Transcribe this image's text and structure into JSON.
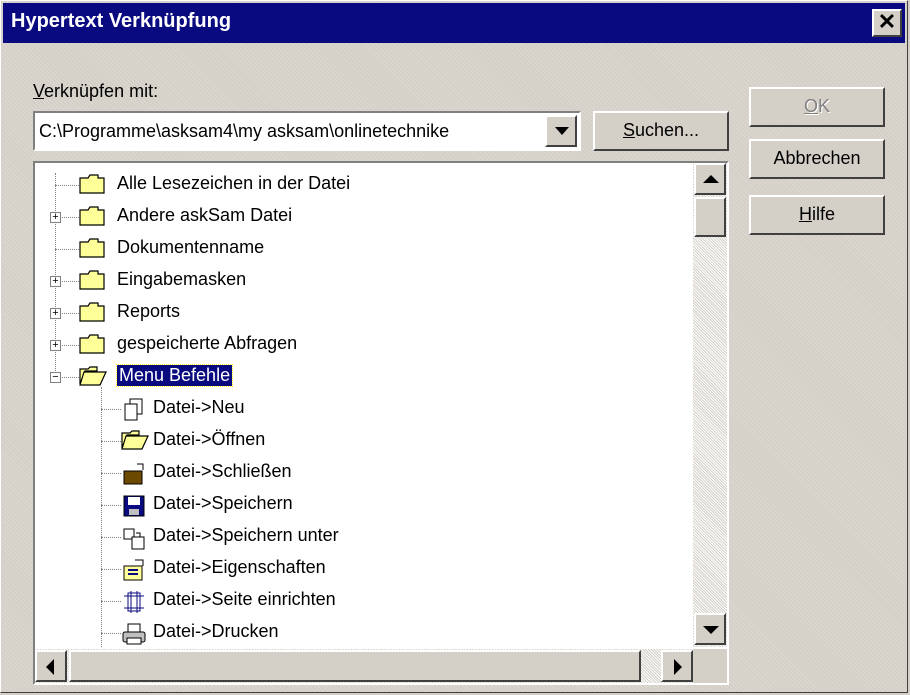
{
  "dialog": {
    "title": "Hypertext Verknüpfung",
    "close_label": "✕"
  },
  "link": {
    "label": "Verknüpfen mit:",
    "value": "C:\\Programme\\asksam4\\my asksam\\onlinetechnike",
    "search_button": "Suchen..."
  },
  "buttons": {
    "ok": "OK",
    "cancel": "Abbrechen",
    "help": "Hilfe"
  },
  "tree": {
    "items": [
      {
        "label": "Alle Lesezeichen in der Datei",
        "icon": "folder-icon",
        "expander": "none",
        "level": 0
      },
      {
        "label": "Andere askSam Datei",
        "icon": "folder-icon",
        "expander": "plus",
        "level": 0
      },
      {
        "label": "Dokumentenname",
        "icon": "folder-icon",
        "expander": "none",
        "level": 0
      },
      {
        "label": "Eingabemasken",
        "icon": "folder-icon",
        "expander": "plus",
        "level": 0
      },
      {
        "label": "Reports",
        "icon": "folder-icon",
        "expander": "plus",
        "level": 0
      },
      {
        "label": "gespeicherte Abfragen",
        "icon": "folder-icon",
        "expander": "plus",
        "level": 0
      },
      {
        "label": "Menu Befehle",
        "icon": "open-folder-icon",
        "expander": "minus",
        "level": 0,
        "selected": true
      },
      {
        "label": "Datei->Neu",
        "icon": "new-file-icon",
        "level": 1
      },
      {
        "label": "Datei->Öffnen",
        "icon": "open-folder-icon",
        "level": 1
      },
      {
        "label": "Datei->Schließen",
        "icon": "close-file-icon",
        "level": 1
      },
      {
        "label": "Datei->Speichern",
        "icon": "save-icon",
        "level": 1
      },
      {
        "label": "Datei->Speichern unter",
        "icon": "save-as-icon",
        "level": 1
      },
      {
        "label": "Datei->Eigenschaften",
        "icon": "properties-icon",
        "level": 1
      },
      {
        "label": "Datei->Seite einrichten",
        "icon": "page-setup-icon",
        "level": 1
      },
      {
        "label": "Datei->Drucken",
        "icon": "printer-icon",
        "level": 1
      }
    ]
  },
  "colors": {
    "titlebar": "#0a0a80",
    "selection": "#0a0a80",
    "folder": "#ffff99"
  }
}
